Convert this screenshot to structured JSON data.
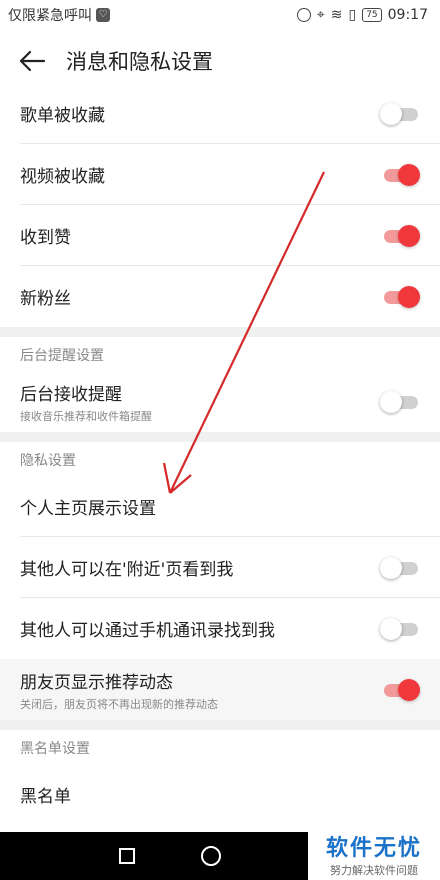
{
  "status_bar": {
    "left_text": "仅限紧急呼叫",
    "battery": "75",
    "time": "09:17"
  },
  "header": {
    "title": "消息和隐私设置"
  },
  "colors": {
    "accent": "#f0383c",
    "accent_track": "#f29a9a",
    "watermark": "#1a73c9"
  },
  "notifications": {
    "items": [
      {
        "label": "歌单被收藏",
        "on": false
      },
      {
        "label": "视频被收藏",
        "on": true
      },
      {
        "label": "收到赞",
        "on": true
      },
      {
        "label": "新粉丝",
        "on": true
      }
    ]
  },
  "background": {
    "header": "后台提醒设置",
    "item_label": "后台接收提醒",
    "item_sub": "接收音乐推荐和收件箱提醒",
    "on": false
  },
  "privacy": {
    "header": "隐私设置",
    "profile_label": "个人主页展示设置",
    "nearby_label": "其他人可以在'附近'页看到我",
    "nearby_on": false,
    "contacts_label": "其他人可以通过手机通讯录找到我",
    "contacts_on": false,
    "friends_label": "朋友页显示推荐动态",
    "friends_sub": "关闭后，朋友页将不再出现新的推荐动态",
    "friends_on": true
  },
  "blacklist": {
    "header": "黑名单设置",
    "item_label": "黑名单"
  },
  "watermark": {
    "title": "软件无忧",
    "subtitle": "努力解决软件问题"
  }
}
